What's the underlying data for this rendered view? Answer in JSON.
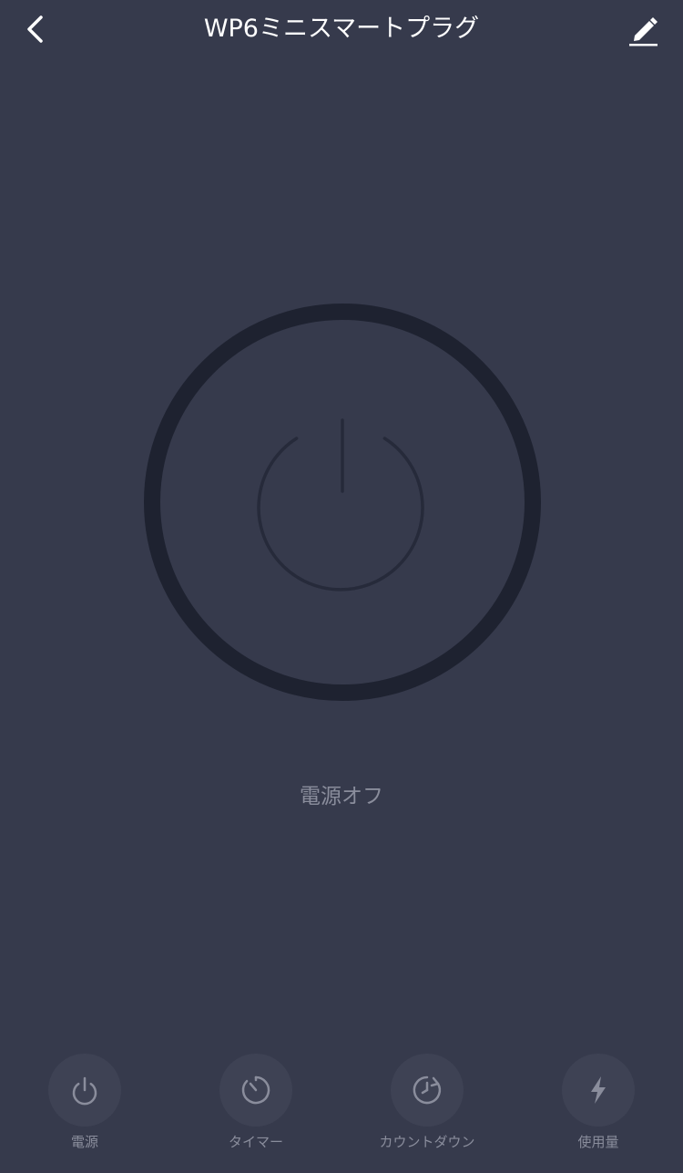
{
  "header": {
    "title": "WP6ミニスマートプラグ",
    "back_icon": "chevron-left-icon",
    "edit_icon": "pencil-icon"
  },
  "main": {
    "power_icon": "power-icon",
    "status": "電源オフ"
  },
  "bottom_bar": {
    "items": [
      {
        "label": "電源",
        "icon": "power-icon"
      },
      {
        "label": "タイマー",
        "icon": "timer-icon"
      },
      {
        "label": "カウントダウン",
        "icon": "countdown-icon"
      },
      {
        "label": "使用量",
        "icon": "lightning-icon"
      }
    ]
  },
  "colors": {
    "background": "#363a4c",
    "ring": "#1e2230",
    "inactive_text": "#8a8d9c",
    "button_bg": "#3e4254"
  }
}
